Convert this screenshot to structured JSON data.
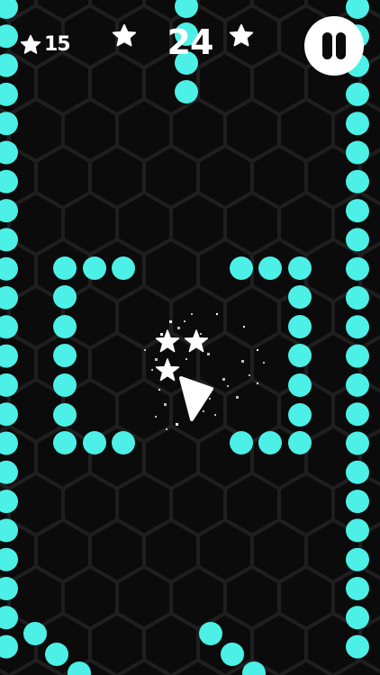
{
  "hud": {
    "star_count": "15",
    "score": "24",
    "pause_icon": "pause-icon",
    "star_icon": "star-icon"
  },
  "colors": {
    "background": "#0b0b0b",
    "hex_grid": "#1f1f1f",
    "dot": "#4cf0e6",
    "white": "#ffffff"
  },
  "game": {
    "player_icon": "triangle-arrow-icon",
    "collectible_icon": "star-icon",
    "collectible_count": 3
  }
}
